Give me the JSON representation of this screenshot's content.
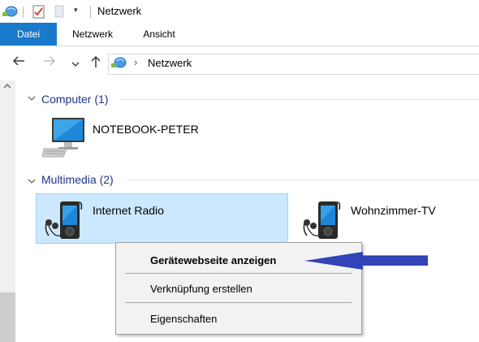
{
  "window": {
    "title": "Netzwerk"
  },
  "ribbon": {
    "tabs": [
      "Datei",
      "Netzwerk",
      "Ansicht"
    ]
  },
  "address": {
    "path": "Netzwerk"
  },
  "groups": [
    {
      "label": "Computer (1)",
      "items": [
        "NOTEBOOK-PETER"
      ]
    },
    {
      "label": "Multimedia (2)",
      "items": [
        "Internet Radio",
        "Wohnzimmer-TV"
      ]
    }
  ],
  "context_menu": {
    "items": [
      "Gerätewebseite anzeigen",
      "Verknüpfung erstellen",
      "Eigenschaften"
    ]
  },
  "colors": {
    "accent": "#1979ca",
    "selection": "#cce8ff",
    "group_heading": "#1e3287",
    "arrow": "#3343b8"
  }
}
